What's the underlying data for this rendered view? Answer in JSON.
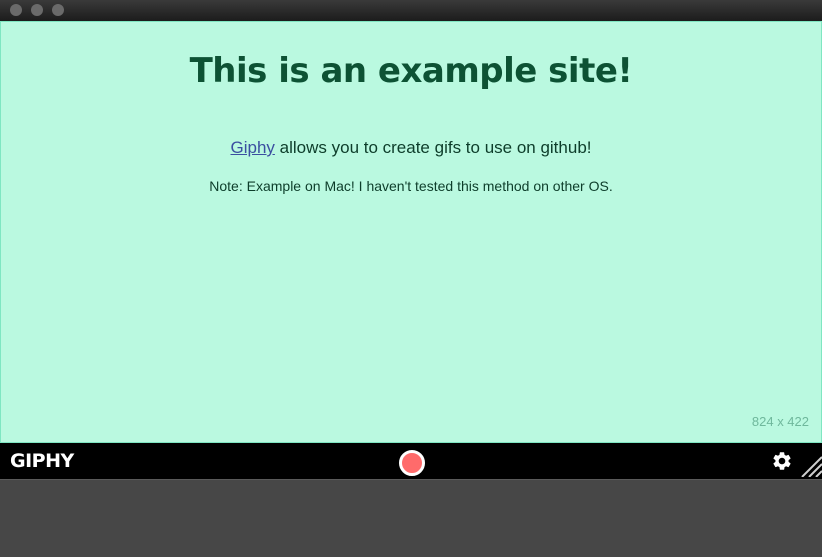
{
  "window": {
    "traffic_lights": [
      "close",
      "minimize",
      "zoom"
    ]
  },
  "site": {
    "title": "This is an example site!",
    "link_text": "Giphy",
    "paragraph_rest": " allows you to create gifs to use on github!",
    "note": "Note: Example on Mac! I haven't tested this method on other OS."
  },
  "capture": {
    "dimensions_label": "824 x 422",
    "background_color": "#baf9e0"
  },
  "toolbar": {
    "logo": "GIPHY",
    "record_icon": "record-icon",
    "settings_icon": "gear-icon",
    "record_color": "#ff6b6b"
  }
}
